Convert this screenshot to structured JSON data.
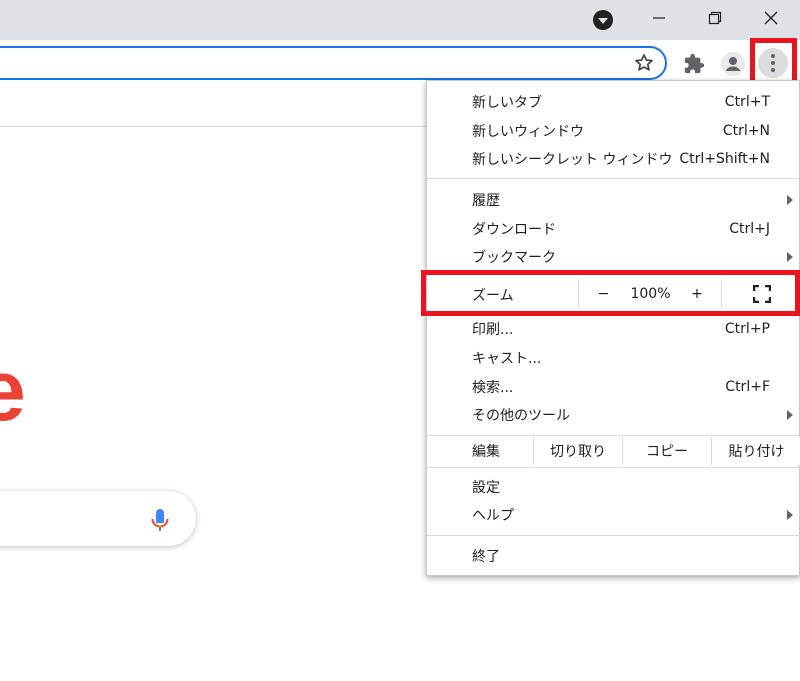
{
  "window_controls": {
    "profile_icon": "dropdown-circle-icon",
    "minimize_icon": "minimize-icon",
    "restore_icon": "restore-icon",
    "close_icon": "close-icon"
  },
  "toolbar": {
    "bookmark_star_icon": "star-outline-icon",
    "extensions_icon": "puzzle-icon",
    "account_icon": "person-icon",
    "menu_icon": "kebab-menu-icon"
  },
  "page": {
    "logo_fragment": "e",
    "mic_icon": "microphone-icon"
  },
  "menu": {
    "group1": [
      {
        "label": "新しいタブ",
        "shortcut": "Ctrl+T"
      },
      {
        "label": "新しいウィンドウ",
        "shortcut": "Ctrl+N"
      },
      {
        "label": "新しいシークレット ウィンドウ",
        "shortcut": "Ctrl+Shift+N"
      }
    ],
    "group2": [
      {
        "label": "履歴",
        "shortcut": ""
      },
      {
        "label": "ダウンロード",
        "shortcut": "Ctrl+J"
      },
      {
        "label": "ブックマーク",
        "shortcut": ""
      }
    ],
    "zoom": {
      "label": "ズーム",
      "minus": "−",
      "level": "100%",
      "plus": "+",
      "fullscreen_icon": "fullscreen-icon"
    },
    "group3": [
      {
        "label": "印刷...",
        "shortcut": "Ctrl+P"
      },
      {
        "label": "キャスト...",
        "shortcut": ""
      },
      {
        "label": "検索...",
        "shortcut": "Ctrl+F"
      },
      {
        "label": "その他のツール",
        "shortcut": ""
      }
    ],
    "edit": {
      "label": "編集",
      "cut": "切り取り",
      "copy": "コピー",
      "paste": "貼り付け"
    },
    "group4": [
      {
        "label": "設定"
      },
      {
        "label": "ヘルプ"
      }
    ],
    "exit": "終了"
  },
  "colors": {
    "highlight": "#e8151e",
    "omnibox_border": "#1a73e8",
    "titlebar": "#dee1e6"
  }
}
